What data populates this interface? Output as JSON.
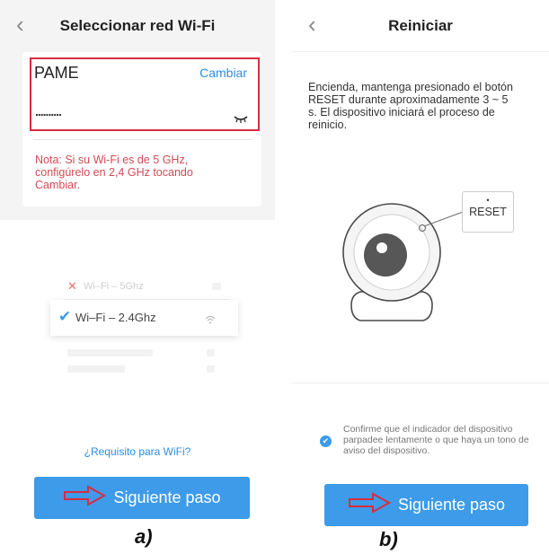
{
  "panel_a": {
    "header": {
      "back_icon": "chevron-left-icon",
      "title": "Seleccionar red Wi-Fi"
    },
    "network": {
      "ssid": "PAME",
      "change_label": "Cambiar",
      "password_mask": "..........",
      "visibility_icon": "eye-closed-icon"
    },
    "note": "Nota: Si su Wi-Fi es de 5 GHz, configúrelo en 2,4 GHz tocando Cambiar.",
    "illustration": {
      "item_5ghz": "Wi–Fi – 5Ghz",
      "item_24ghz": "Wi–Fi – 2.4Ghz"
    },
    "requirement_link": "¿Requisito para WiFi?",
    "next_button": "Siguiente paso",
    "caption": "a)"
  },
  "panel_b": {
    "header": {
      "back_icon": "chevron-left-icon",
      "title": "Reiniciar"
    },
    "instructions": "Encienda, mantenga presionado el botón RESET durante aproximadamente 3 ~ 5 s. El dispositivo iniciará el proceso de reinicio.",
    "reset_dot": "•",
    "reset_label": "RESET",
    "confirm_text": "Confirme que el indicador del dispositivo parpadee lentamente o que haya un tono de aviso del dispositivo.",
    "next_button": "Siguiente paso",
    "caption": "b)"
  },
  "colors": {
    "accent": "#3d9be9",
    "link": "#2b8fe6",
    "warning": "#d24a55",
    "highlight_box": "#d62d3e",
    "background_gray": "#f4f4f4"
  }
}
